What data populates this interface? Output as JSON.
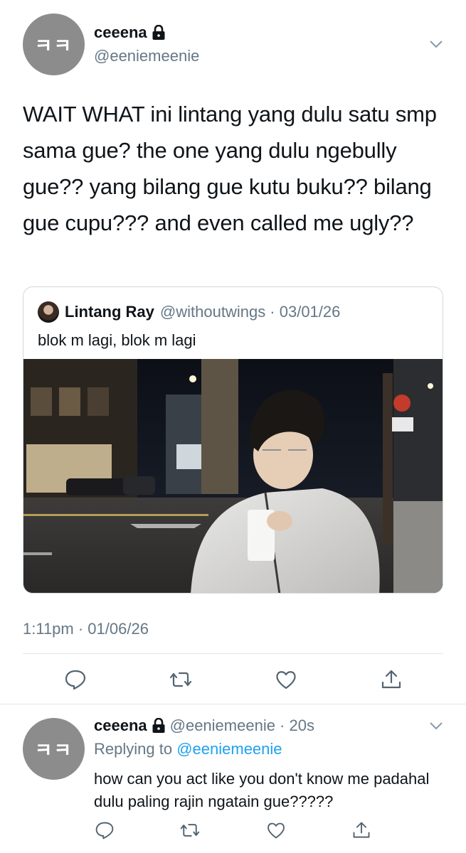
{
  "tweet": {
    "avatar_text": "ㅋㅋ",
    "display_name": "ceeena",
    "handle": "@eeniemeenie",
    "text": "WAIT WHAT ini lintang yang dulu satu smp sama gue? the one yang dulu ngebully gue?? yang bilang gue kutu buku?? bilang gue cupu??? and even called me ugly??",
    "timestamp": "1:11pm · 01/06/26"
  },
  "quote": {
    "display_name": "Lintang Ray",
    "meta": "@withoutwings · 03/01/26",
    "text": "blok m lagi, blok m lagi"
  },
  "actions": [
    "reply-icon",
    "retweet-icon",
    "like-icon",
    "share-icon"
  ],
  "reply": {
    "avatar_text": "ㅋㅋ",
    "display_name": "ceeena",
    "meta": "@eeniemeenie · 20s",
    "replying_prefix": "Replying to",
    "replying_handle": "@eeniemeenie",
    "text": "how can you act like you don't know me padahal dulu paling rajin ngatain gue?????"
  },
  "colors": {
    "text": "#0f1419",
    "secondary": "#657786",
    "link": "#1da1f2",
    "border": "#cfd9de",
    "avatar": "#8c8c8c"
  }
}
